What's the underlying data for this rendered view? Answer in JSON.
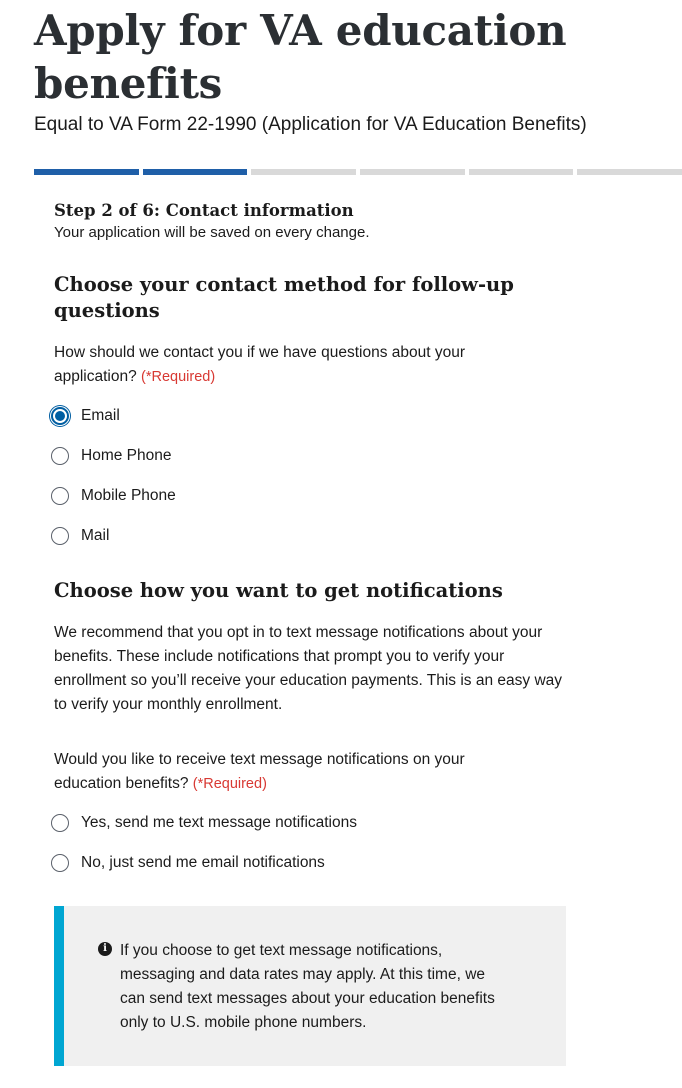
{
  "header": {
    "title": "Apply for VA education benefits",
    "subtitle": "Equal to VA Form 22-1990 (Application for VA Education Benefits)"
  },
  "progress": {
    "total_steps": 6,
    "completed_steps": 2,
    "active_color": "#1f5fa8",
    "inactive_color": "#d9d9d9"
  },
  "step": {
    "heading": "Step 2 of 6: Contact information",
    "note": "Your application will be saved on every change."
  },
  "contact_method": {
    "heading": "Choose your contact method for follow-up questions",
    "question": "How should we contact you if we have questions about your application?",
    "required_label": "(*Required)",
    "options": [
      {
        "label": "Email",
        "selected": true
      },
      {
        "label": "Home Phone",
        "selected": false
      },
      {
        "label": "Mobile Phone",
        "selected": false
      },
      {
        "label": "Mail",
        "selected": false
      }
    ]
  },
  "notifications": {
    "heading": "Choose how you want to get notifications",
    "intro": "We recommend that you opt in to text message notifications about your benefits. These include notifications that prompt you to verify your enrollment so you’ll receive your education payments. This is an easy way to verify your monthly enrollment.",
    "question": "Would you like to receive text message notifications on your education benefits?",
    "required_label": "(*Required)",
    "options": [
      {
        "label": "Yes, send me text message notifications",
        "selected": false
      },
      {
        "label": "No, just send me email notifications",
        "selected": false
      }
    ]
  },
  "alert": {
    "icon": "info-icon",
    "text": "If you choose to get text message notifications, messaging and data rates may apply. At this time, we can send text messages about your education benefits only to U.S. mobile phone numbers.",
    "accent_color": "#00a6d2"
  },
  "colors": {
    "required": "#d83933",
    "radio_selected": "#005ea2"
  }
}
